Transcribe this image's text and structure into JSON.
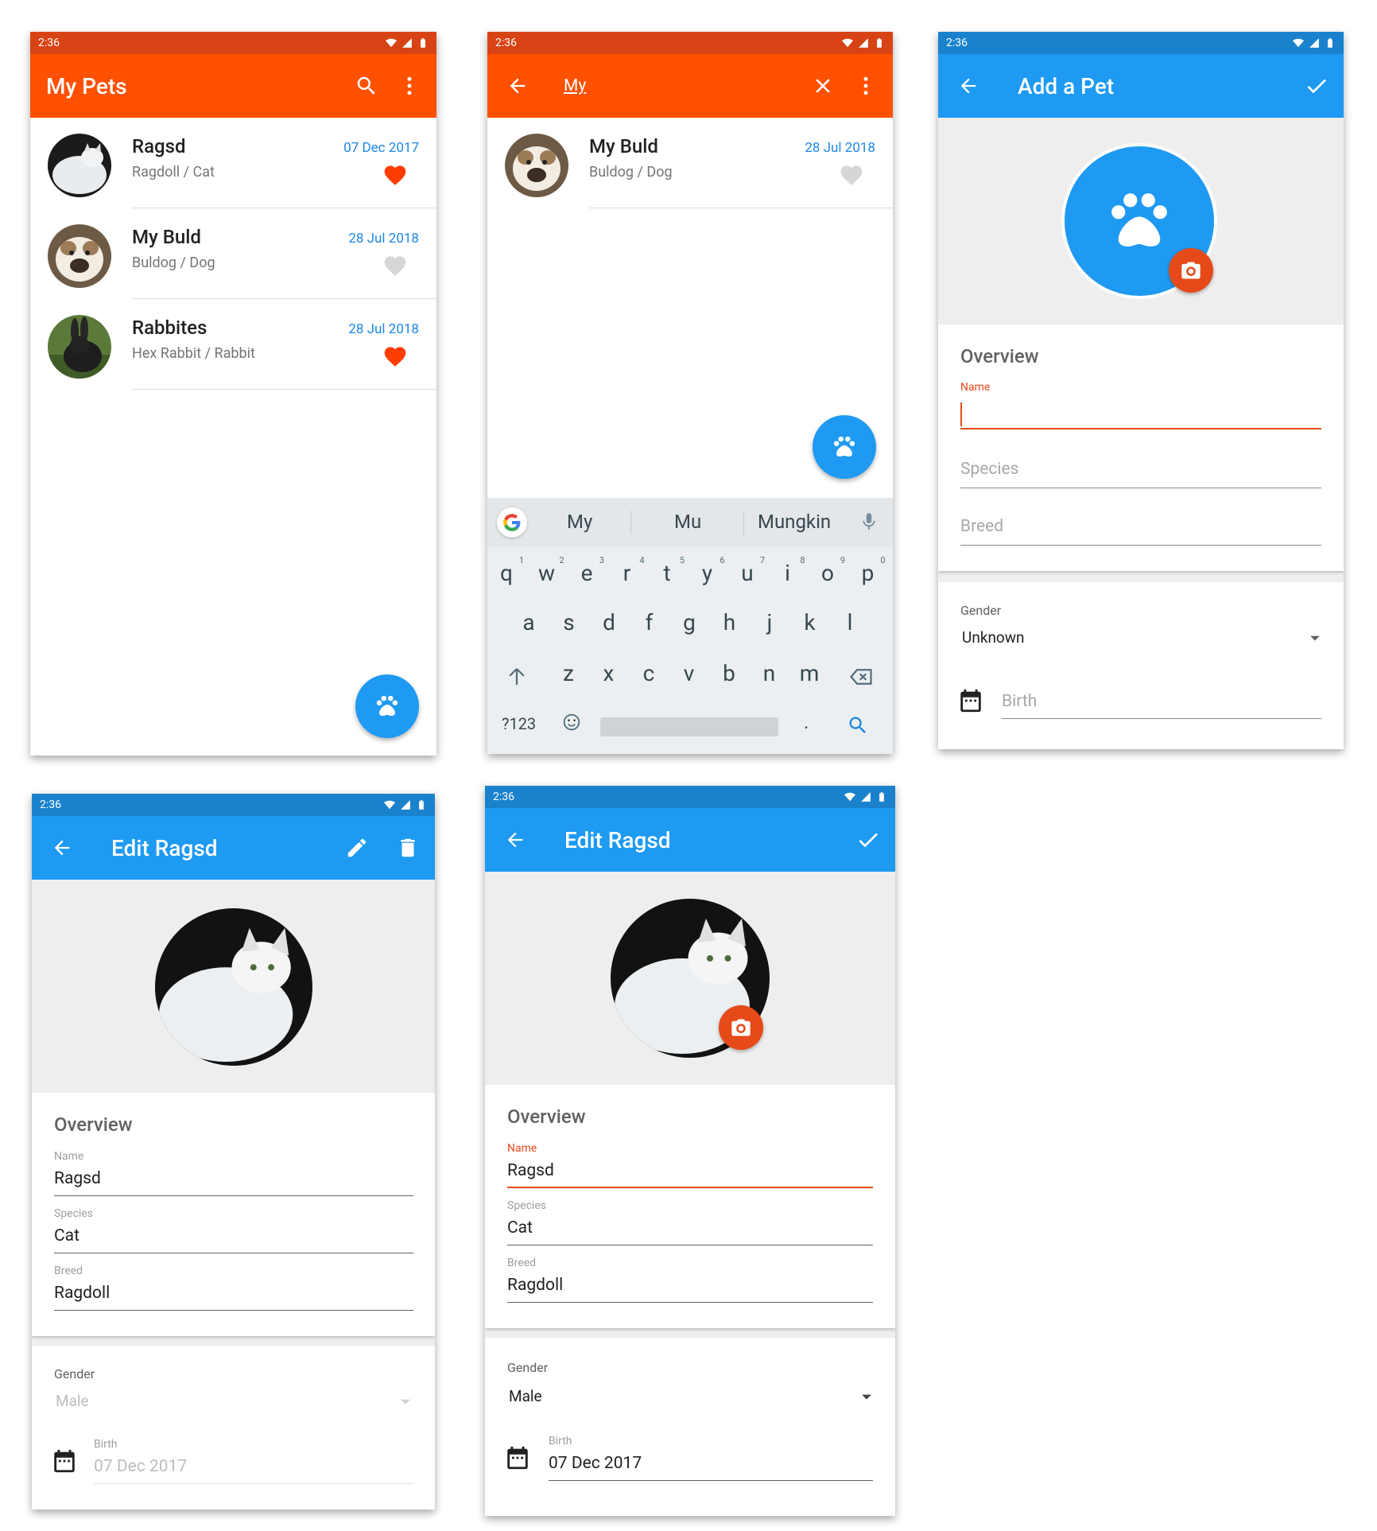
{
  "status": {
    "time": "2:36"
  },
  "screen1": {
    "title": "My Pets",
    "pets": [
      {
        "name": "Ragsd",
        "sub": "Ragdoll / Cat",
        "date": "07 Dec 2017",
        "favorite": true,
        "avatar": "cat"
      },
      {
        "name": "My Buld",
        "sub": "Buldog / Dog",
        "date": "28 Jul 2018",
        "favorite": false,
        "avatar": "dog"
      },
      {
        "name": "Rabbites",
        "sub": "Hex Rabbit / Rabbit",
        "date": "28 Jul 2018",
        "favorite": true,
        "avatar": "rabbit"
      }
    ]
  },
  "screen2": {
    "search_query": "My",
    "result": {
      "name": "My Buld",
      "sub": "Buldog / Dog",
      "date": "28 Jul 2018",
      "favorite": false
    },
    "suggestions": [
      "My",
      "Mu",
      "Mungkin"
    ],
    "keyboard": {
      "row1": [
        {
          "k": "q",
          "n": "1"
        },
        {
          "k": "w",
          "n": "2"
        },
        {
          "k": "e",
          "n": "3"
        },
        {
          "k": "r",
          "n": "4"
        },
        {
          "k": "t",
          "n": "5"
        },
        {
          "k": "y",
          "n": "6"
        },
        {
          "k": "u",
          "n": "7"
        },
        {
          "k": "i",
          "n": "8"
        },
        {
          "k": "o",
          "n": "9"
        },
        {
          "k": "p",
          "n": "0"
        }
      ],
      "row2": [
        "a",
        "s",
        "d",
        "f",
        "g",
        "h",
        "j",
        "k",
        "l"
      ],
      "row3": [
        "z",
        "x",
        "c",
        "v",
        "b",
        "n",
        "m"
      ],
      "symbols": "?123",
      "period": "."
    }
  },
  "screen3": {
    "title": "Add a Pet",
    "overview": "Overview",
    "name_label": "Name",
    "species_placeholder": "Species",
    "breed_placeholder": "Breed",
    "gender_label": "Gender",
    "gender_value": "Unknown",
    "birth_placeholder": "Birth"
  },
  "screen4": {
    "title": "Edit Ragsd",
    "overview": "Overview",
    "name_label": "Name",
    "name_value": "Ragsd",
    "species_label": "Species",
    "species_value": "Cat",
    "breed_label": "Breed",
    "breed_value": "Ragdoll",
    "gender_label": "Gender",
    "gender_value": "Male",
    "birth_label": "Birth",
    "birth_value": "07 Dec 2017"
  },
  "screen5": {
    "title": "Edit Ragsd",
    "overview": "Overview",
    "name_label": "Name",
    "name_value": "Ragsd",
    "species_label": "Species",
    "species_value": "Cat",
    "breed_label": "Breed",
    "breed_value": "Ragdoll",
    "gender_label": "Gender",
    "gender_value": "Male",
    "birth_label": "Birth",
    "birth_value": "07 Dec 2017"
  },
  "colors": {
    "orange": "#ff5100",
    "orange_dark": "#d84315",
    "blue": "#1e9af2",
    "blue_dark": "#1a82cd",
    "accent_red": "#e64a19",
    "date_blue": "#1e88e5"
  }
}
